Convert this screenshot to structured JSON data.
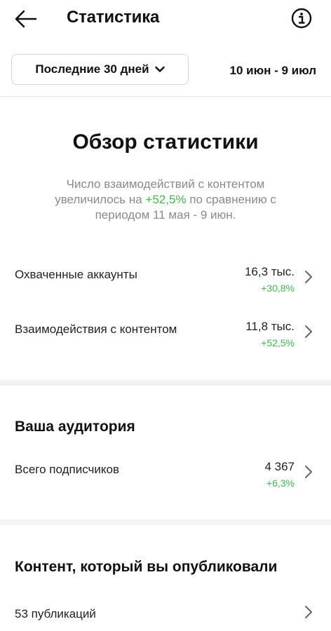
{
  "header": {
    "title": "Статистика",
    "back_icon": "arrow-left-icon",
    "info_icon": "info-circle-icon"
  },
  "filter": {
    "range_label": "Последние 30 дней",
    "dropdown_icon": "chevron-down-icon",
    "date_range": "10 июн - 9 июл"
  },
  "overview": {
    "title": "Обзор статистики",
    "text_before": "Число взаимодействий с контентом увеличилось на ",
    "highlight": "+52,5%",
    "text_after": " по сравнению с периодом 11 мая - 9 июн."
  },
  "metrics": [
    {
      "label": "Охваченные аккаунты",
      "value": "16,3 тыс.",
      "change": "+30,8%"
    },
    {
      "label": "Взаимодействия с контентом",
      "value": "11,8 тыс.",
      "change": "+52,5%"
    }
  ],
  "audience": {
    "title": "Ваша аудитория",
    "label": "Всего подписчиков",
    "value": "4 367",
    "change": "+6,3%"
  },
  "content": {
    "title": "Контент, который вы опубликовали",
    "label": "53 публикаций"
  },
  "colors": {
    "positive": "#3fb950",
    "muted_text": "#8a8a8a",
    "separator": "#f3f3f3"
  }
}
